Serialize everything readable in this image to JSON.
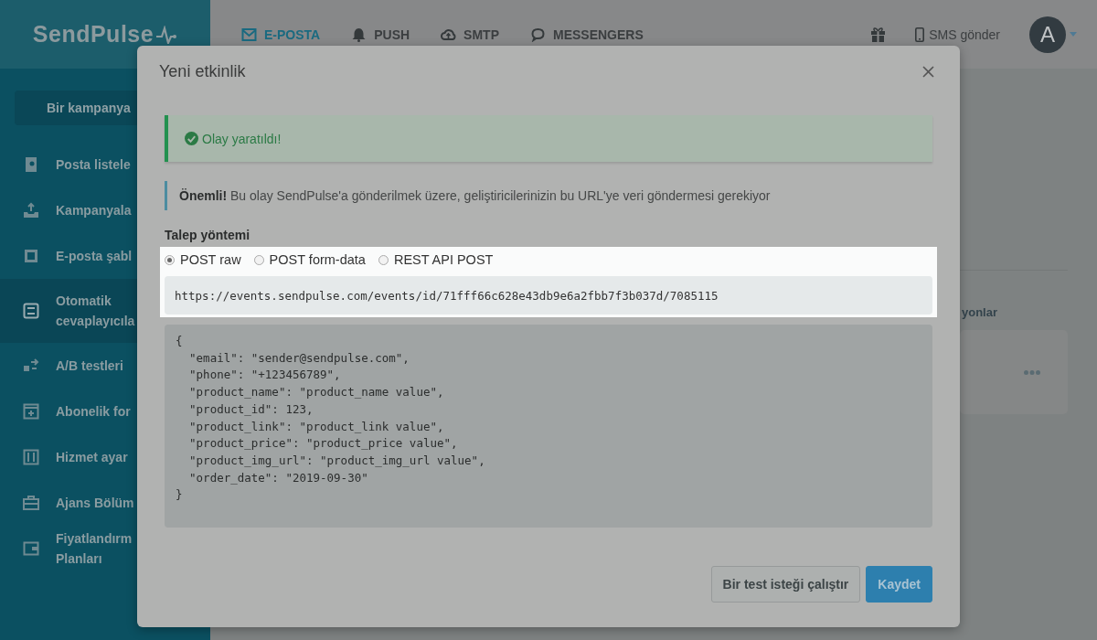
{
  "header": {
    "logo": "SendPulse",
    "nav": [
      {
        "label": "E-POSTA",
        "selected": true
      },
      {
        "label": "PUSH",
        "selected": false
      },
      {
        "label": "SMTP",
        "selected": false
      },
      {
        "label": "MESSENGERS",
        "selected": false
      }
    ],
    "sms_button": "SMS gönder",
    "avatar": "A"
  },
  "sidebar": {
    "create_button": "Bir kampanya",
    "items": [
      {
        "label": "Posta listele",
        "selected": false
      },
      {
        "label": "Kampanyala",
        "selected": false
      },
      {
        "label": "E-posta şabl",
        "selected": false
      },
      {
        "label": "Otomatik cevaplayıcıla",
        "selected": true
      },
      {
        "label": "A/B testleri",
        "selected": false
      },
      {
        "label": "Abonelik for",
        "selected": false
      },
      {
        "label": "Hizmet ayar",
        "selected": false
      },
      {
        "label": "Ajans Bölüm",
        "selected": false
      },
      {
        "label": "Fiyatlandırm Planları",
        "selected": false
      }
    ]
  },
  "background": {
    "section_title": "yonlar"
  },
  "modal": {
    "title": "Yeni etkinlik",
    "success_alert": "Olay yaratıldı!",
    "info_note": "**Önemli!** Bu olay SendPulse'a gönderilmek üzere, geliştiricilerinizin bu URL'ye veri göndermesi gerekiyor",
    "method_label": "Talep yöntemi",
    "methods": [
      {
        "label": "POST raw",
        "selected": true
      },
      {
        "label": "POST form-data",
        "selected": false
      },
      {
        "label": "REST API POST",
        "selected": false
      }
    ],
    "url": "https://events.sendpulse.com/events/id/71fff66c628e43db9e6a2fbb7f3b037d/7085115",
    "code_lines": [
      "{",
      "  \"email\": \"sender@sendpulse.com\",",
      "  \"phone\": \"+123456789\",",
      "  \"product_name\": \"product_name value\",",
      "  \"product_id\": 123,",
      "  \"product_link\": \"product_link value\",",
      "  \"product_price\": \"product_price value\",",
      "  \"product_img_url\": \"product_img_url value\",",
      "  \"order_date\": \"2019-09-30\"",
      "}"
    ],
    "buttons": [
      {
        "label": "Bir test isteği çalıştır",
        "kind": "secondary"
      },
      {
        "label": "Kaydet",
        "kind": "primary"
      }
    ]
  }
}
